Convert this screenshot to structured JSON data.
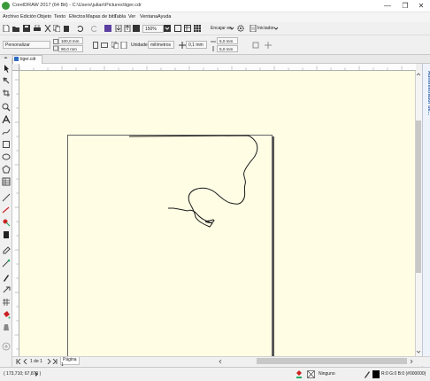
{
  "window": {
    "title": "CorelDRAW 2017 (64 Bit) - C:\\Users\\julian\\Pictures\\tiger.cdr",
    "minimize": "—",
    "restore": "❐",
    "close": "✕"
  },
  "menu": [
    "Archivo",
    "Edición",
    "Objeto",
    "Texto",
    "Efectos",
    "Mapas de bits",
    "Tabla",
    "Ver",
    "Ventana",
    "Ayuda"
  ],
  "toolbar": {
    "zoom_value": "150%",
    "snap_label": "Encajar en",
    "launch_label": "Iniciador"
  },
  "property_bar": {
    "page_size": "Personalizar",
    "width": "100,0 mm",
    "height": "90,0 mm",
    "units_label": "Unidades:",
    "units_value": "milímetros",
    "nudge": "0,1 mm",
    "dup_x": "5,0 mm",
    "dup_y": "5,0 mm"
  },
  "document_tab": {
    "label": "tiger.cdr"
  },
  "docker": {
    "label": "Administrador de..."
  },
  "page_nav": {
    "page_count": "1 de 1",
    "page_tab": "Página 1"
  },
  "status": {
    "coords": "( 173,710; 67,879 )",
    "fill_label": "Ninguno",
    "outline_label": "R:0 G:0 B:0 (#000000)"
  },
  "colors": {
    "canvas": "#fffde4",
    "drawing_stroke": "#1a1a1a",
    "docker_accent": "#2a5fa8"
  }
}
